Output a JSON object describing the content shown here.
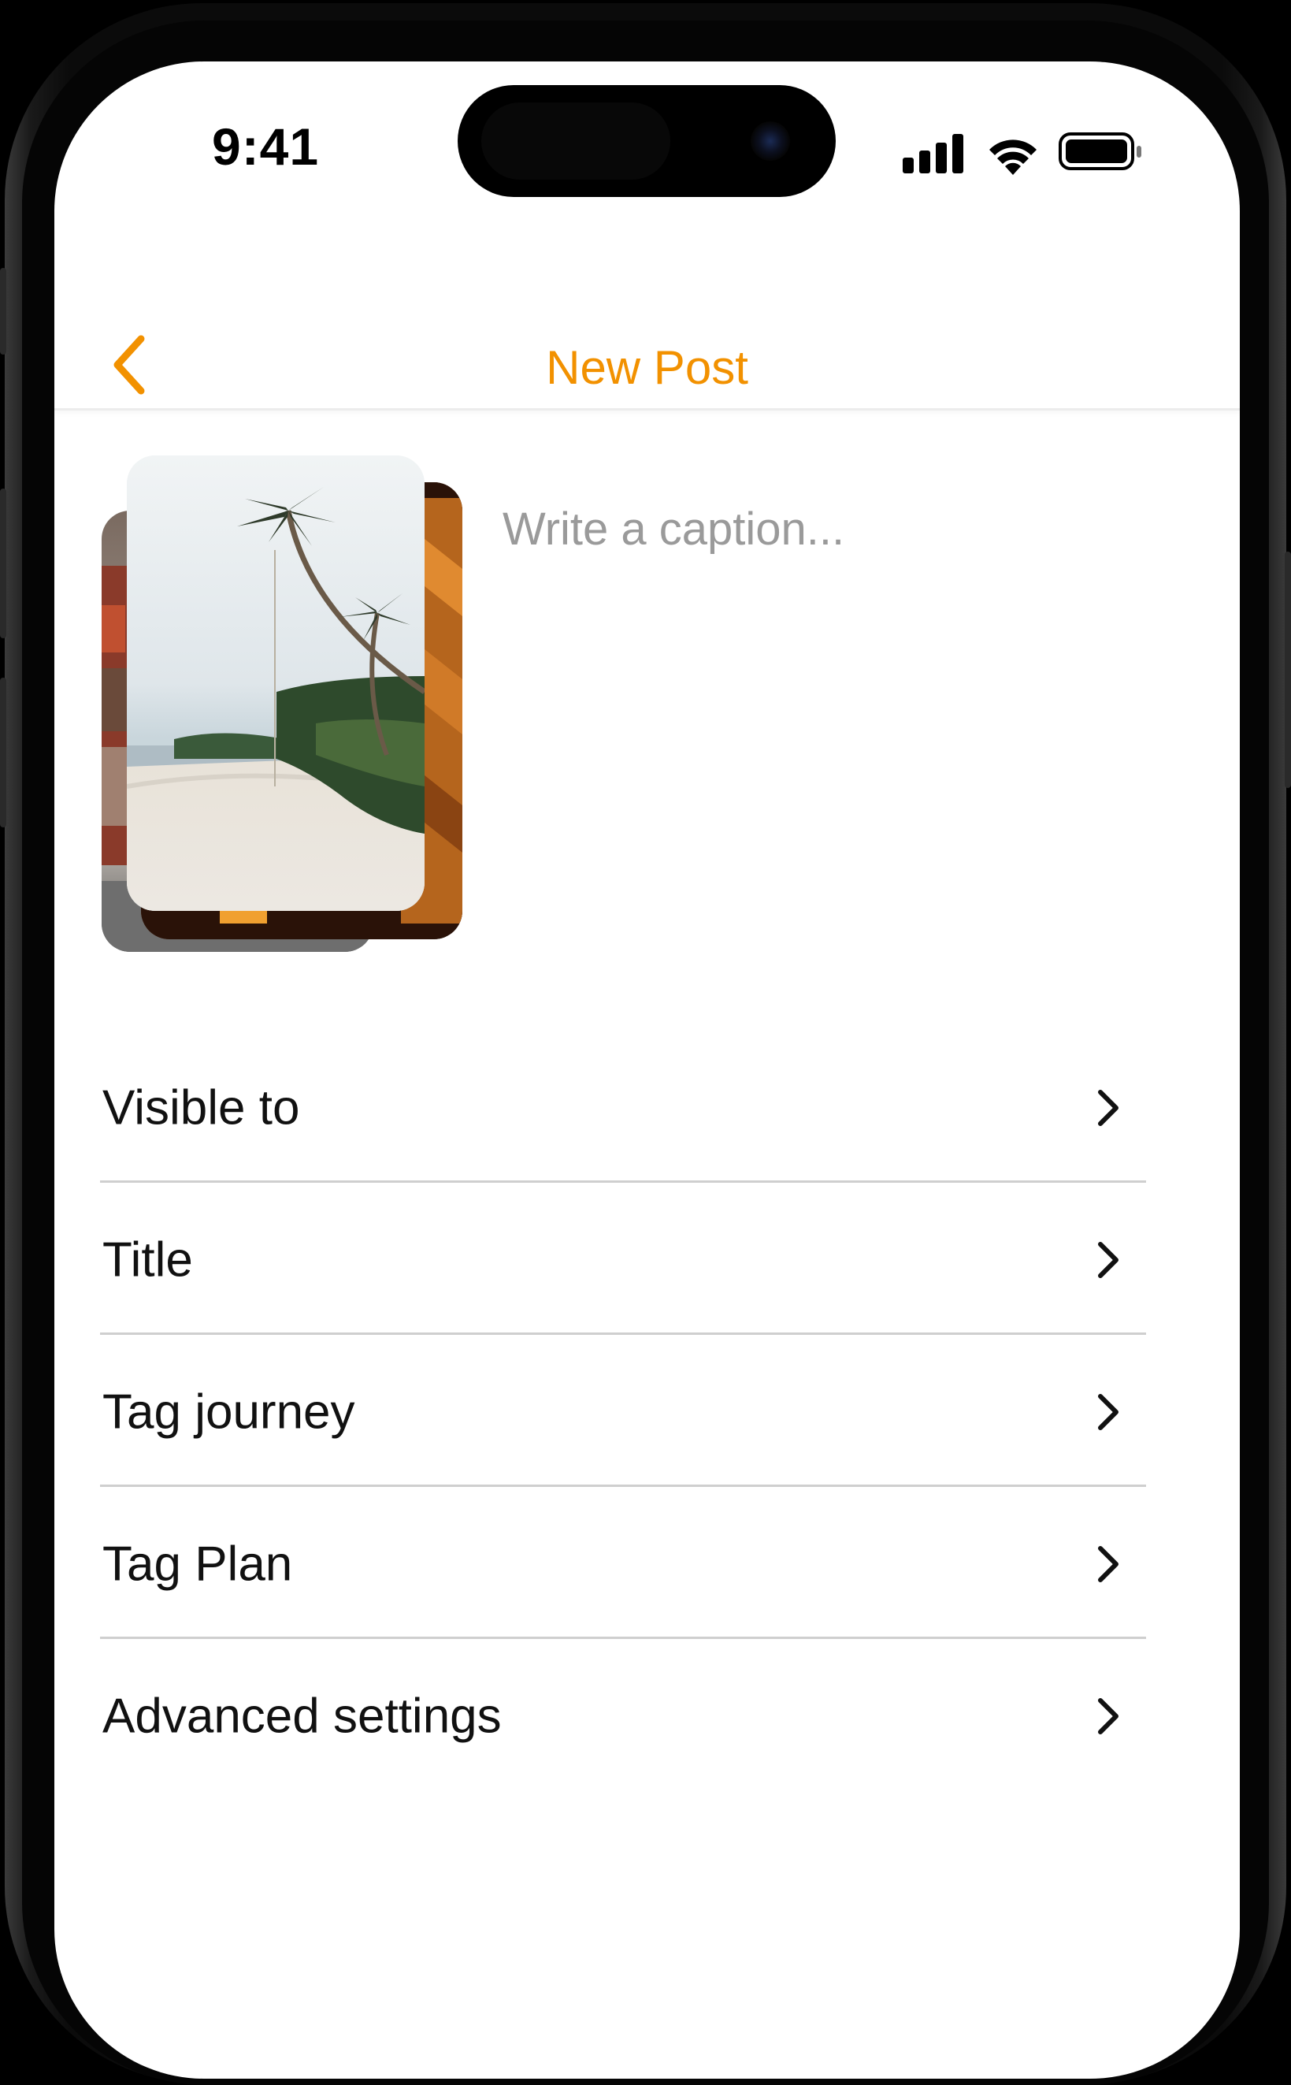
{
  "status_bar": {
    "time": "9:41"
  },
  "header": {
    "title": "New Post",
    "back_icon": "chevron-left-icon"
  },
  "colors": {
    "accent": "#F29100",
    "text_primary": "#111111",
    "placeholder": "#9A9A9A",
    "divider": "#CFCFCF"
  },
  "media": {
    "photo_count_visible": 3
  },
  "caption": {
    "placeholder": "Write a caption..."
  },
  "settings": {
    "items": [
      {
        "label": "Visible to"
      },
      {
        "label": "Title"
      },
      {
        "label": "Tag journey"
      },
      {
        "label": "Tag Plan"
      },
      {
        "label": "Advanced settings"
      }
    ],
    "chevron_icon": "chevron-right-icon"
  }
}
